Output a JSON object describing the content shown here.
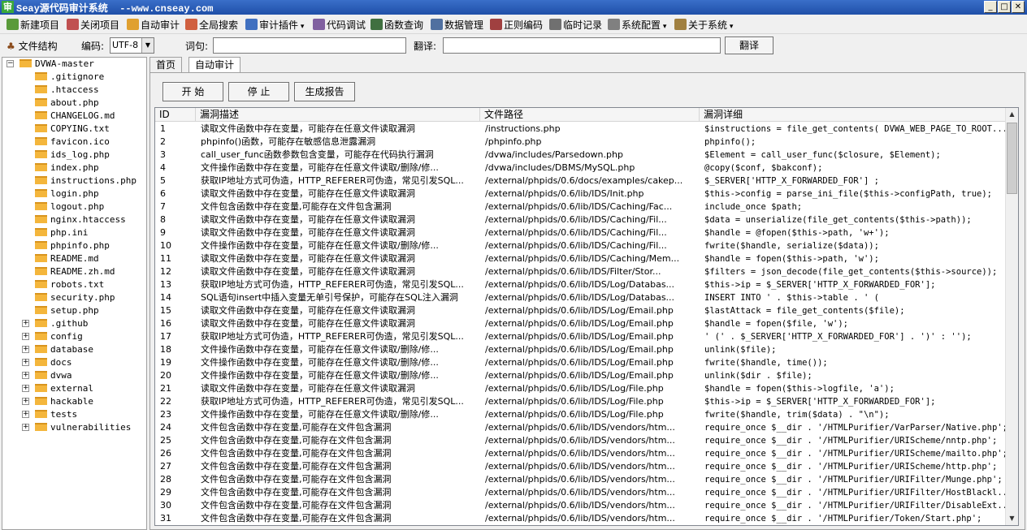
{
  "window": {
    "title": "Seay源代码审计系统  --www.cnseay.com",
    "icon_char": "审"
  },
  "menu": [
    {
      "label": "新建项目",
      "icon": "new-project-icon",
      "color": "#5a9a3a"
    },
    {
      "label": "关闭项目",
      "icon": "close-project-icon",
      "color": "#c05050"
    },
    {
      "label": "自动审计",
      "icon": "auto-audit-icon",
      "color": "#e0a030"
    },
    {
      "label": "全局搜索",
      "icon": "global-search-icon",
      "color": "#d06040"
    },
    {
      "label": "审计插件",
      "icon": "plugin-icon",
      "color": "#4070c0",
      "dropdown": true
    },
    {
      "label": "代码调试",
      "icon": "debug-icon",
      "color": "#8060a0"
    },
    {
      "label": "函数查询",
      "icon": "function-search-icon",
      "color": "#407040"
    },
    {
      "label": "数据管理",
      "icon": "data-manage-icon",
      "color": "#5070a0"
    },
    {
      "label": "正则编码",
      "icon": "regex-icon",
      "color": "#a04040"
    },
    {
      "label": "临时记录",
      "icon": "notes-icon",
      "color": "#707070"
    },
    {
      "label": "系统配置",
      "icon": "settings-icon",
      "color": "#808080",
      "dropdown": true
    },
    {
      "label": "关于系统",
      "icon": "about-icon",
      "color": "#a08040",
      "dropdown": true
    }
  ],
  "toolbar": {
    "file_structure_label": "文件结构",
    "encoding_label": "编码:",
    "encoding_value": "UTF-8",
    "word_label": "词句:",
    "word_value": "",
    "translate_label": "翻译:",
    "translate_value": "",
    "translate_button": "翻译"
  },
  "tree": {
    "root": "DVWA-master",
    "files": [
      ".gitignore",
      ".htaccess",
      "about.php",
      "CHANGELOG.md",
      "COPYING.txt",
      "favicon.ico",
      "ids_log.php",
      "index.php",
      "instructions.php",
      "login.php",
      "logout.php",
      "nginx.htaccess",
      "php.ini",
      "phpinfo.php",
      "README.md",
      "README.zh.md",
      "robots.txt",
      "security.php",
      "setup.php"
    ],
    "folders": [
      ".github",
      "config",
      "database",
      "docs",
      "dvwa",
      "external",
      "hackable",
      "tests",
      "vulnerabilities"
    ]
  },
  "tabs": [
    "首页",
    "自动审计"
  ],
  "buttons": {
    "start": "开  始",
    "stop": "停  止",
    "report": "生成报告"
  },
  "grid": {
    "headers": [
      "ID",
      "漏洞描述",
      "文件路径",
      "漏洞详细"
    ],
    "rows": [
      [
        "1",
        "读取文件函数中存在变量，可能存在任意文件读取漏洞",
        "/instructions.php",
        "$instructions = file_get_contents( DVWA_WEB_PAGE_TO_ROOT...."
      ],
      [
        "2",
        "phpinfo()函数，可能存在敏感信息泄露漏洞",
        "/phpinfo.php",
        "phpinfo();"
      ],
      [
        "3",
        "call_user_func函数参数包含变量，可能存在代码执行漏洞",
        "/dvwa/includes/Parsedown.php",
        "$Element = call_user_func($closure, $Element);"
      ],
      [
        "4",
        "文件操作函数中存在变量，可能存在任意文件读取/删除/修...",
        "/dvwa/includes/DBMS/MySQL.php",
        "@copy($conf, $bakconf);"
      ],
      [
        "5",
        "获取IP地址方式可伪造，HTTP_REFERER可伪造，常见引发SQL...",
        "/external/phpids/0.6/docs/examples/cakep...",
        "$_SERVER['HTTP_X_FORWARDED_FOR'] ;"
      ],
      [
        "6",
        "读取文件函数中存在变量，可能存在任意文件读取漏洞",
        "/external/phpids/0.6/lib/IDS/Init.php",
        "$this->config = parse_ini_file($this->configPath, true);"
      ],
      [
        "7",
        "文件包含函数中存在变量,可能存在文件包含漏洞",
        "/external/phpids/0.6/lib/IDS/Caching/Fac...",
        "include_once $path;"
      ],
      [
        "8",
        "读取文件函数中存在变量，可能存在任意文件读取漏洞",
        "/external/phpids/0.6/lib/IDS/Caching/Fil...",
        "$data = unserialize(file_get_contents($this->path));"
      ],
      [
        "9",
        "读取文件函数中存在变量，可能存在任意文件读取漏洞",
        "/external/phpids/0.6/lib/IDS/Caching/Fil...",
        "$handle = @fopen($this->path, 'w+');"
      ],
      [
        "10",
        "文件操作函数中存在变量，可能存在任意文件读取/删除/修...",
        "/external/phpids/0.6/lib/IDS/Caching/Fil...",
        "fwrite($handle, serialize($data));"
      ],
      [
        "11",
        "读取文件函数中存在变量，可能存在任意文件读取漏洞",
        "/external/phpids/0.6/lib/IDS/Caching/Mem...",
        "$handle = fopen($this->path, 'w');"
      ],
      [
        "12",
        "读取文件函数中存在变量，可能存在任意文件读取漏洞",
        "/external/phpids/0.6/lib/IDS/Filter/Stor...",
        "$filters = json_decode(file_get_contents($this->source));"
      ],
      [
        "13",
        "获取IP地址方式可伪造，HTTP_REFERER可伪造，常见引发SQL...",
        "/external/phpids/0.6/lib/IDS/Log/Databas...",
        "$this->ip = $_SERVER['HTTP_X_FORWARDED_FOR'];"
      ],
      [
        "14",
        "SQL语句insert中插入变量无单引号保护，可能存在SQL注入漏洞",
        "/external/phpids/0.6/lib/IDS/Log/Databas...",
        "INSERT INTO ' . $this->table . ' ("
      ],
      [
        "15",
        "读取文件函数中存在变量，可能存在任意文件读取漏洞",
        "/external/phpids/0.6/lib/IDS/Log/Email.php",
        "$lastAttack = file_get_contents($file);"
      ],
      [
        "16",
        "读取文件函数中存在变量，可能存在任意文件读取漏洞",
        "/external/phpids/0.6/lib/IDS/Log/Email.php",
        "$handle = fopen($file, 'w');"
      ],
      [
        "17",
        "获取IP地址方式可伪造，HTTP_REFERER可伪造，常见引发SQL...",
        "/external/phpids/0.6/lib/IDS/Log/Email.php",
        "' (' . $_SERVER['HTTP_X_FORWARDED_FOR'] . ')' : '');"
      ],
      [
        "18",
        "文件操作函数中存在变量，可能存在任意文件读取/删除/修...",
        "/external/phpids/0.6/lib/IDS/Log/Email.php",
        "unlink($file);"
      ],
      [
        "19",
        "文件操作函数中存在变量，可能存在任意文件读取/删除/修...",
        "/external/phpids/0.6/lib/IDS/Log/Email.php",
        "fwrite($handle, time());"
      ],
      [
        "20",
        "文件操作函数中存在变量，可能存在任意文件读取/删除/修...",
        "/external/phpids/0.6/lib/IDS/Log/Email.php",
        "unlink($dir . $file);"
      ],
      [
        "21",
        "读取文件函数中存在变量，可能存在任意文件读取漏洞",
        "/external/phpids/0.6/lib/IDS/Log/File.php",
        "$handle = fopen($this->logfile, 'a');"
      ],
      [
        "22",
        "获取IP地址方式可伪造，HTTP_REFERER可伪造，常见引发SQL...",
        "/external/phpids/0.6/lib/IDS/Log/File.php",
        "$this->ip = $_SERVER['HTTP_X_FORWARDED_FOR'];"
      ],
      [
        "23",
        "文件操作函数中存在变量，可能存在任意文件读取/删除/修...",
        "/external/phpids/0.6/lib/IDS/Log/File.php",
        "fwrite($handle, trim($data) . \"\\n\");"
      ],
      [
        "24",
        "文件包含函数中存在变量,可能存在文件包含漏洞",
        "/external/phpids/0.6/lib/IDS/vendors/htm...",
        "require_once $__dir . '/HTMLPurifier/VarParser/Native.php';"
      ],
      [
        "25",
        "文件包含函数中存在变量,可能存在文件包含漏洞",
        "/external/phpids/0.6/lib/IDS/vendors/htm...",
        "require_once $__dir . '/HTMLPurifier/URIScheme/nntp.php';"
      ],
      [
        "26",
        "文件包含函数中存在变量,可能存在文件包含漏洞",
        "/external/phpids/0.6/lib/IDS/vendors/htm...",
        "require_once $__dir . '/HTMLPurifier/URIScheme/mailto.php';"
      ],
      [
        "27",
        "文件包含函数中存在变量,可能存在文件包含漏洞",
        "/external/phpids/0.6/lib/IDS/vendors/htm...",
        "require_once $__dir . '/HTMLPurifier/URIScheme/http.php';"
      ],
      [
        "28",
        "文件包含函数中存在变量,可能存在文件包含漏洞",
        "/external/phpids/0.6/lib/IDS/vendors/htm...",
        "require_once $__dir . '/HTMLPurifier/URIFilter/Munge.php';"
      ],
      [
        "29",
        "文件包含函数中存在变量,可能存在文件包含漏洞",
        "/external/phpids/0.6/lib/IDS/vendors/htm...",
        "require_once $__dir . '/HTMLPurifier/URIFilter/HostBlackl..."
      ],
      [
        "30",
        "文件包含函数中存在变量,可能存在文件包含漏洞",
        "/external/phpids/0.6/lib/IDS/vendors/htm...",
        "require_once $__dir . '/HTMLPurifier/URIFilter/DisableExt..."
      ],
      [
        "31",
        "文件包含函数中存在变量,可能存在文件包含漏洞",
        "/external/phpids/0.6/lib/IDS/vendors/htm...",
        "require_once $__dir . '/HTMLPurifier/Token/Start.php';"
      ]
    ]
  }
}
